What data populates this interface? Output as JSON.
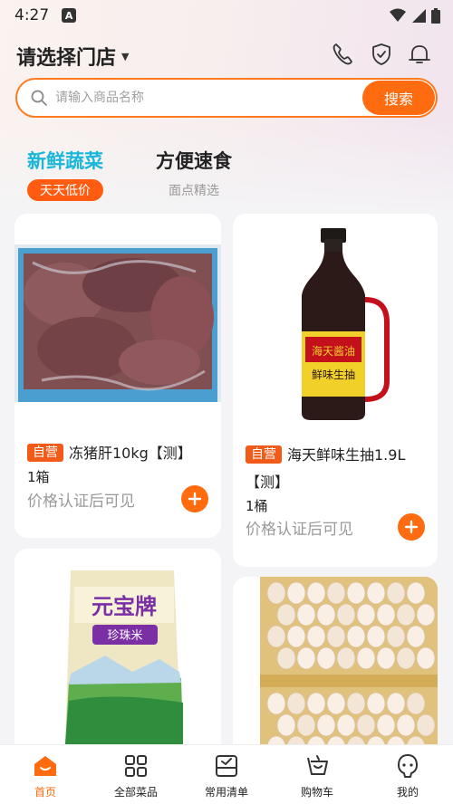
{
  "status_bar": {
    "time": "4:27",
    "notification_glyph": "A"
  },
  "header": {
    "store_label": "请选择门店",
    "icons": [
      "phone-icon",
      "shield-check-icon",
      "bell-icon"
    ]
  },
  "search": {
    "placeholder": "请输入商品名称",
    "button_label": "搜索"
  },
  "tabs": [
    {
      "title": "新鲜蔬菜",
      "badge": "天天低价",
      "active": true
    },
    {
      "title": "方便速食",
      "subtitle": "面点精选",
      "active": false
    }
  ],
  "products": [
    {
      "tag": "自营",
      "name": "冻猪肝10kg【测】",
      "unit": "1箱",
      "price_text": "价格认证后可见"
    },
    {
      "tag": "自营",
      "name": "海天鲜味生抽1.9L【测】",
      "unit": "1桶",
      "price_text": "价格认证后可见"
    },
    {
      "brand_text": "元宝牌",
      "brand_sub": "珍珠米"
    },
    {}
  ],
  "soy_label": {
    "brand": "海天酱油",
    "product": "鲜味生抽"
  },
  "bottom_nav": [
    {
      "label": "首页",
      "icon": "home-icon",
      "active": true
    },
    {
      "label": "全部菜品",
      "icon": "grid-icon",
      "active": false
    },
    {
      "label": "常用清单",
      "icon": "checklist-icon",
      "active": false
    },
    {
      "label": "购物车",
      "icon": "cart-icon",
      "active": false
    },
    {
      "label": "我的",
      "icon": "profile-icon",
      "active": false
    }
  ],
  "colors": {
    "accent": "#ff6b0f",
    "tab_active": "#19b6d8",
    "tag": "#f25a1a"
  }
}
